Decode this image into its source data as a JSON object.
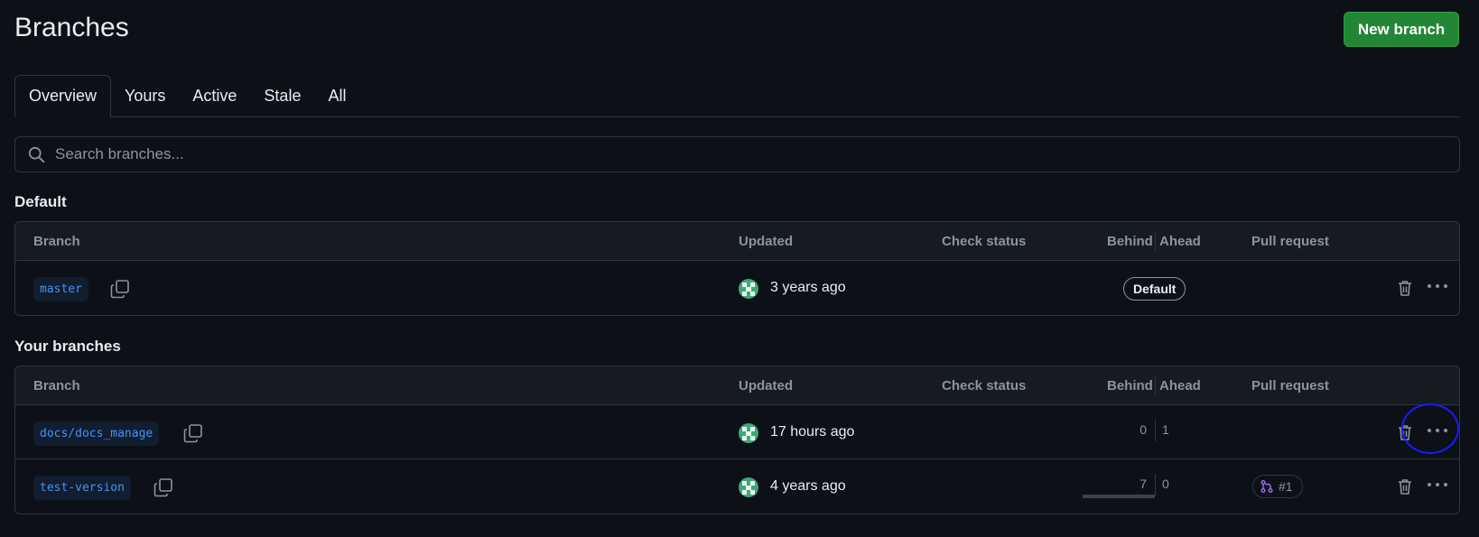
{
  "page": {
    "title": "Branches",
    "new_branch_label": "New branch"
  },
  "tabs": [
    {
      "label": "Overview",
      "selected": true
    },
    {
      "label": "Yours"
    },
    {
      "label": "Active"
    },
    {
      "label": "Stale"
    },
    {
      "label": "All"
    }
  ],
  "search": {
    "placeholder": "Search branches...",
    "icon": "search-icon"
  },
  "columns": {
    "branch": "Branch",
    "updated": "Updated",
    "check_status": "Check status",
    "behind": "Behind",
    "ahead": "Ahead",
    "pull_request": "Pull request"
  },
  "default_section": {
    "heading": "Default",
    "rows": [
      {
        "branch": "master",
        "updated": "3 years ago",
        "badge": "Default"
      }
    ]
  },
  "your_section": {
    "heading": "Your branches",
    "rows": [
      {
        "branch": "docs/docs_manage",
        "updated": "17 hours ago",
        "behind": "0",
        "ahead": "1",
        "pull_request": ""
      },
      {
        "branch": "test-version",
        "updated": "4 years ago",
        "behind": "7",
        "ahead": "0",
        "pull_request": "#1"
      }
    ]
  },
  "colors": {
    "background": "#0d1117",
    "header_bg": "#161b22",
    "border": "#30363d",
    "primary_button": "#238636",
    "branch_link": "#4493f8",
    "pr_icon": "#a371f7",
    "annotation": "#1a1aff"
  },
  "icons": [
    "copy-icon",
    "trash-icon",
    "kebab-icon",
    "git-pull-request-icon",
    "avatar-icon"
  ]
}
